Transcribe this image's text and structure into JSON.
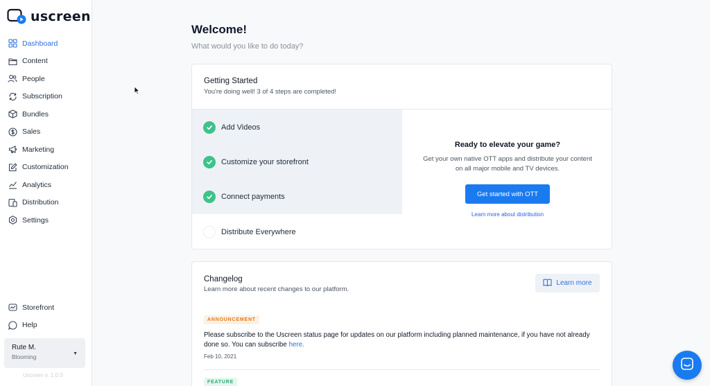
{
  "brand": {
    "name": "uscreen",
    "accent": "#1a7bf0"
  },
  "sidebar": {
    "items": [
      {
        "label": "Dashboard",
        "icon": "grid-icon"
      },
      {
        "label": "Content",
        "icon": "folder-icon"
      },
      {
        "label": "People",
        "icon": "users-icon"
      },
      {
        "label": "Subscription",
        "icon": "refresh-icon"
      },
      {
        "label": "Bundles",
        "icon": "box-icon"
      },
      {
        "label": "Sales",
        "icon": "dollar-icon"
      },
      {
        "label": "Marketing",
        "icon": "megaphone-icon"
      },
      {
        "label": "Customization",
        "icon": "edit-icon"
      },
      {
        "label": "Analytics",
        "icon": "chart-icon"
      },
      {
        "label": "Distribution",
        "icon": "devices-icon"
      },
      {
        "label": "Settings",
        "icon": "gear-icon"
      }
    ],
    "bottom_items": [
      {
        "label": "Storefront",
        "icon": "storefront-icon"
      },
      {
        "label": "Help",
        "icon": "help-bubble-icon"
      }
    ],
    "user": {
      "name": "Rute M.",
      "plan": "Blooming"
    },
    "version": "Uscreen v. 1.0.0"
  },
  "main": {
    "title": "Welcome!",
    "subtitle": "What would you like to do today?",
    "getting_started": {
      "title": "Getting Started",
      "progress_text": "You're doing well! 3 of 4 steps are completed!",
      "steps": [
        {
          "label": "Add Videos",
          "done": true
        },
        {
          "label": "Customize your storefront",
          "done": true
        },
        {
          "label": "Connect payments",
          "done": true
        },
        {
          "label": "Distribute Everywhere",
          "done": false
        }
      ],
      "ott": {
        "title": "Ready to elevate your game?",
        "description": "Get your own native OTT apps and distribute your content on all major mobile and TV devices.",
        "button": "Get started with OTT",
        "link": "Learn more about distribution"
      }
    },
    "changelog": {
      "title": "Changelog",
      "subtitle": "Learn more about recent changes to our platform.",
      "learn_more": "Learn more",
      "entries": [
        {
          "badge": "ANNOUNCEMENT",
          "text": "Please subscribe to the Uscreen status page for updates on our platform including planned maintenance, if you have not already done so. You can subscribe ",
          "link": "here.",
          "date": "Feb 10, 2021"
        },
        {
          "badge": "FEATURE"
        }
      ]
    }
  }
}
